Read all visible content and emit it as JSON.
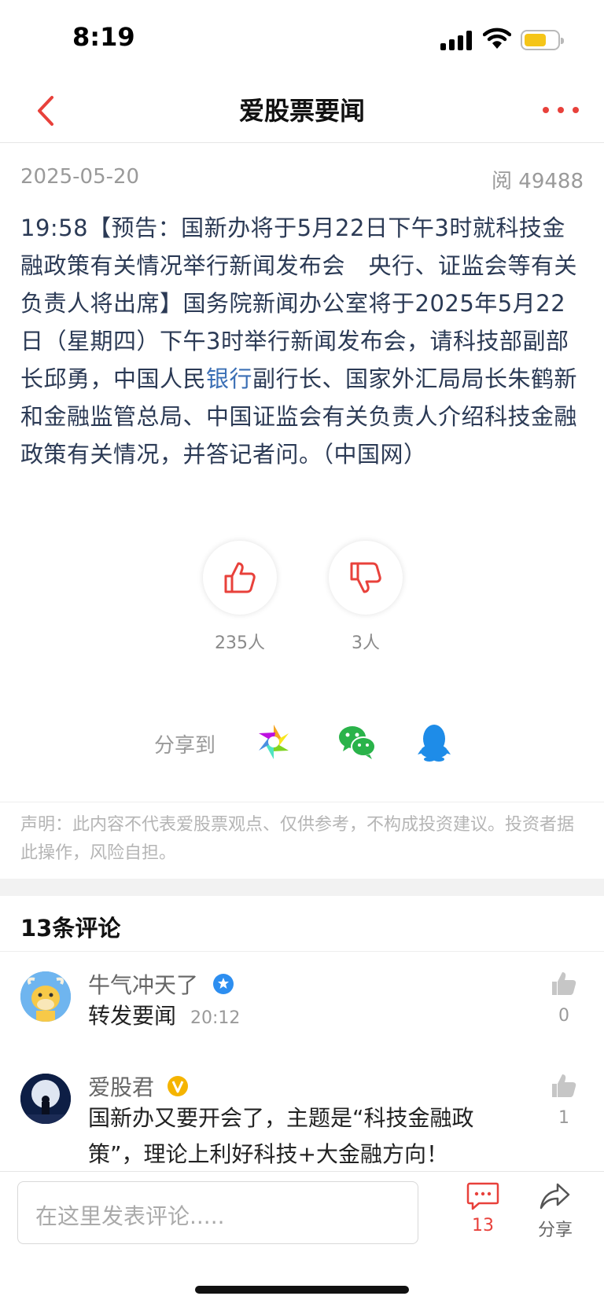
{
  "status_bar": {
    "time": "8:19"
  },
  "nav": {
    "title": "爱股票要闻"
  },
  "article": {
    "date": "2025-05-20",
    "reads": "阅 49488",
    "body_before_link": "19:58【预告：国新办将于5月22日下午3时就科技金融政策有关情况举行新闻发布会　央行、证监会等有关负责人将出席】国务院新闻办公室将于2025年5月22日（星期四）下午3时举行新闻发布会，请科技部副部长邱勇，中国人民",
    "body_link": "银行",
    "body_after_link": "副行长、国家外汇局局长朱鹤新和金融监管总局、中国证监会有关负责人介绍科技金融政策有关情况，并答记者问。（中国网）"
  },
  "votes": {
    "up_count": "235人",
    "down_count": "3人"
  },
  "share": {
    "label": "分享到"
  },
  "disclaimer": "声明：此内容不代表爱股票观点、仅供参考，不构成投资建议。投资者据此操作，风险自担。",
  "comments": {
    "title": "13条评论",
    "items": [
      {
        "user": "牛气冲天了",
        "text": "转发要闻",
        "time": "20:12",
        "likes": "0"
      },
      {
        "user": "爱股君",
        "text": "国新办又要开会了，主题是“科技金融政策”，理论上利好科技+大金融方向！",
        "likes": "1"
      }
    ]
  },
  "bottom_bar": {
    "input_placeholder": "在这里发表评论.....",
    "comment_count": "13",
    "share_label": "分享"
  },
  "colors": {
    "accent": "#e8413b",
    "link": "#3b6fb5",
    "article_text": "#2b3a55"
  }
}
